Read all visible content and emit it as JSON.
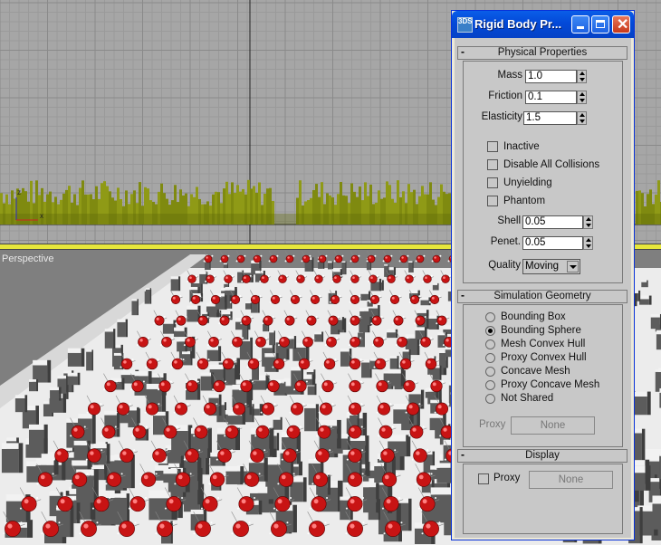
{
  "viewports": {
    "perspective_label": "Perspective"
  },
  "window": {
    "title": "Rigid Body Pr...",
    "app_icon_text": "3DS",
    "controls": [
      "minimize-icon",
      "maximize-icon",
      "close-icon"
    ]
  },
  "physical": {
    "title": "Physical Properties",
    "collapse": "-",
    "mass_label": "Mass",
    "mass_value": "1.0",
    "friction_label": "Friction",
    "friction_value": "0.1",
    "elasticity_label": "Elasticity",
    "elasticity_value": "1.5",
    "checkboxes": [
      {
        "label": "Inactive",
        "checked": false
      },
      {
        "label": "Disable All Collisions",
        "checked": false
      },
      {
        "label": "Unyielding",
        "checked": false
      },
      {
        "label": "Phantom",
        "checked": false
      }
    ],
    "shell_label": "Shell",
    "shell_value": "0.05",
    "penet_label": "Penet.",
    "penet_value": "0.05",
    "quality_label": "Quality",
    "quality_value": "Moving"
  },
  "simulation": {
    "title": "Simulation Geometry",
    "collapse": "-",
    "options": [
      {
        "label": "Bounding Box",
        "selected": false
      },
      {
        "label": "Bounding Sphere",
        "selected": true
      },
      {
        "label": "Mesh Convex Hull",
        "selected": false
      },
      {
        "label": "Proxy Convex Hull",
        "selected": false
      },
      {
        "label": "Concave Mesh",
        "selected": false
      },
      {
        "label": "Proxy Concave Mesh",
        "selected": false
      },
      {
        "label": "Not Shared",
        "selected": false
      }
    ],
    "proxy_label": "Proxy",
    "proxy_button": "None"
  },
  "display": {
    "title": "Display",
    "collapse": "-",
    "proxy_label": "Proxy",
    "proxy_button": "None"
  },
  "colors": {
    "titlebar": "#0349d8",
    "panel": "#c8c8c8",
    "spheres": "#c81414",
    "buildings_top": "#8f9a16"
  }
}
